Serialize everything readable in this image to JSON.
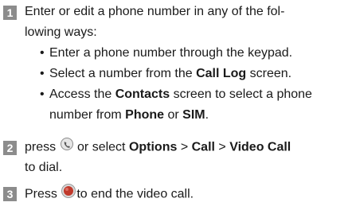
{
  "steps": [
    {
      "number": "1",
      "lines": [
        "Enter or edit a phone number in any of the fol-",
        "lowing ways:"
      ],
      "bullets": [
        {
          "t1": "Enter a phone number through the keypad."
        },
        {
          "t1": "Select a number from the ",
          "b1": "Call Log",
          "t2": " screen."
        },
        {
          "t1": "Access the ",
          "b1": "Contacts",
          "t2": " screen to select a phone"
        },
        {
          "t1": "number from ",
          "b1": "Phone",
          "t2": " or ",
          "b2": "SIM",
          "t3": "."
        }
      ]
    },
    {
      "number": "2",
      "line1": {
        "t1": "press ",
        "icon": "call-key-icon",
        "t2": " or select ",
        "b1": "Options",
        "t3": " > ",
        "b2": "Call",
        "t4": " > ",
        "b3": "Video Call"
      },
      "line2": "to dial."
    },
    {
      "number": "3",
      "line1": {
        "t1": "Press ",
        "icon": "end-key-icon",
        "t2": "to end the video call."
      }
    }
  ],
  "colors": {
    "badge": "#8c8c8c",
    "end_key": "#c0392b"
  }
}
